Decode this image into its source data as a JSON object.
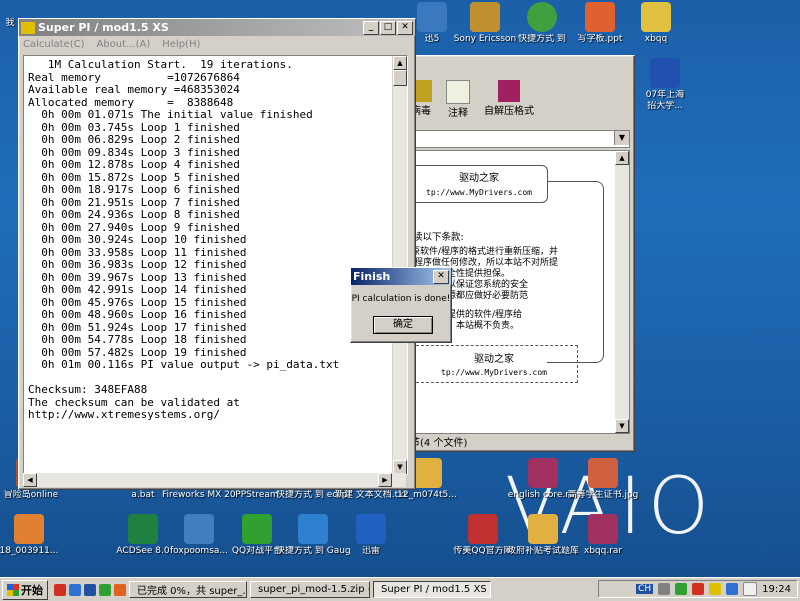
{
  "superpi": {
    "title": "Super PI / mod1.5 XS",
    "menu": [
      "Calculate(C)",
      "About...(A)",
      "Help(H)"
    ],
    "output": [
      "   1M Calculation Start.  19 iterations.",
      "Real memory          =1072676864",
      "Available real memory =468353024",
      "Allocated memory     =  8388648",
      "  0h 00m 01.071s The initial value finished",
      "  0h 00m 03.745s Loop 1 finished",
      "  0h 00m 06.829s Loop 2 finished",
      "  0h 00m 09.834s Loop 3 finished",
      "  0h 00m 12.878s Loop 4 finished",
      "  0h 00m 15.872s Loop 5 finished",
      "  0h 00m 18.917s Loop 6 finished",
      "  0h 00m 21.951s Loop 7 finished",
      "  0h 00m 24.936s Loop 8 finished",
      "  0h 00m 27.940s Loop 9 finished",
      "  0h 00m 30.924s Loop 10 finished",
      "  0h 00m 33.958s Loop 11 finished",
      "  0h 00m 36.983s Loop 12 finished",
      "  0h 00m 39.967s Loop 13 finished",
      "  0h 00m 42.991s Loop 14 finished",
      "  0h 00m 45.976s Loop 15 finished",
      "  0h 00m 48.960s Loop 16 finished",
      "  0h 00m 51.924s Loop 17 finished",
      "  0h 00m 54.778s Loop 18 finished",
      "  0h 00m 57.482s Loop 19 finished",
      "  0h 01m 00.116s PI value output -> pi_data.txt",
      "",
      "Checksum: 348EFA88",
      "The checksum can be validated at",
      "http://www.xtremesystems.org/"
    ]
  },
  "finish_dialog": {
    "title": "Finish",
    "message": "PI calculation is done!",
    "ok": "确定"
  },
  "background_window": {
    "toolbar": [
      "病毒",
      "注释",
      "自解压格式"
    ],
    "box1_title": "驱动之家",
    "box1_url": "tp://www.MyDrivers.com",
    "notice_heading": "读以下条款:",
    "notice_lines": [
      "原软件/程序的格式进行重新压缩，并",
      "/程序做任何修改，所以本站不对所提",
      "整性和安全性提供担保。",
      "毒操作，以保证您系统的安全",
      "的所有资源都应做好必要防范",
      "，对于所提供的软件/程序给",
      "成的后果，本站概不负责。"
    ],
    "box2_title": "驱动之家",
    "box2_url": "tp://www.MyDrivers.com",
    "status": "节(4 个文件)"
  },
  "desktop_icons_top": [
    "我",
    "迅5",
    "Sony Ericsson",
    "快捷方式 到",
    "写字板.ppt",
    "xbqq"
  ],
  "desktop_icons_right": [
    "07年上海",
    "招大学..."
  ],
  "desktop_icons_row1": [
    {
      "label": "冒险岛online",
      "color": "#c04a20"
    },
    {
      "label": "a.bat",
      "color": "#e0e0e0"
    },
    {
      "label": "Fireworks MX 2004",
      "color": "#d9a030"
    },
    {
      "label": "PPStream",
      "color": "#3070c0"
    },
    {
      "label": "快捷方式 到 eclipse.exe",
      "color": "#6050a0"
    },
    {
      "label": "新建 文本文档.txt",
      "color": "#f0f0f0"
    },
    {
      "label": "12_m074t5...",
      "color": "#e0b040"
    },
    {
      "label": "english core.rar",
      "color": "#a03060"
    },
    {
      "label": "高等学生证书.jpg",
      "color": "#d06040"
    }
  ],
  "desktop_icons_row2": [
    {
      "label": "18_003911...",
      "color": "#e08030"
    },
    {
      "label": "ACDSee 8.0",
      "color": "#208040"
    },
    {
      "label": "foxpoomsa...",
      "color": "#4080c0"
    },
    {
      "label": "QQ对战平台",
      "color": "#30a030"
    },
    {
      "label": "快捷方式 到 Gauge.exe",
      "color": "#3080d0"
    },
    {
      "label": "迅雷",
      "color": "#2060c0"
    },
    {
      "label": "传美QQ官方网",
      "color": "#c03030"
    },
    {
      "label": "政府补贴考试题库",
      "color": "#e0b040"
    },
    {
      "label": "xbqq.rar",
      "color": "#a03060"
    }
  ],
  "taskbar": {
    "start": "开始",
    "items": [
      "已完成 0%，共 super_...",
      "super_pi_mod-1.5.zip - ...",
      "Super PI / mod1.5 XS"
    ],
    "lang": "CH",
    "time": "19:24"
  }
}
